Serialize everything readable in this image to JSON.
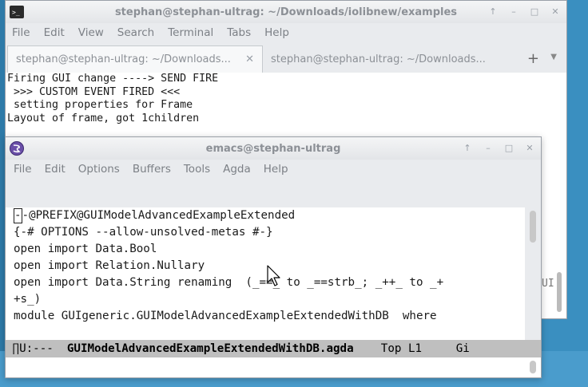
{
  "terminal": {
    "title": "stephan@stephan-ultrag: ~/Downloads/iolibnew/examples",
    "window_buttons": [
      "↑",
      "–",
      "□",
      "✕"
    ],
    "menu": [
      "File",
      "Edit",
      "View",
      "Search",
      "Terminal",
      "Tabs",
      "Help"
    ],
    "tabs": [
      {
        "label": "stephan@stephan-ultrag: ~/Downloads...",
        "close": "✕"
      },
      {
        "label": "stephan@stephan-ultrag: ~/Downloads..."
      }
    ],
    "new_tab": "+",
    "tab_menu": "▼",
    "lines": [
      "Firing GUI change ----> SEND FIRE",
      " >>> CUSTOM EVENT FIRED <<<",
      " setting properties for Frame",
      "Layout of frame, got 1children"
    ],
    "peek_text": "UI"
  },
  "emacs": {
    "title": "emacs@stephan-ultrag",
    "window_buttons": [
      "↑",
      "–",
      "□",
      "✕"
    ],
    "menu": [
      "File",
      "Edit",
      "Options",
      "Buffers",
      "Tools",
      "Agda",
      "Help"
    ],
    "cursor_char": "-",
    "line1_rest": "-@PREFIX@GUIModelAdvancedExampleExtended",
    "lines": [
      "{-# OPTIONS --allow-unsolved-metas #-}",
      "open import Data.Bool",
      "open import Relation.Nullary",
      "open import Data.String renaming  (_==_ to _==strb_; _++_ to _+",
      "+s_)",
      "module GUIgeneric.GUIModelAdvancedExampleExtendedWithDB  where"
    ],
    "modeline": {
      "status": " ∏U:--- ",
      "buffer": " GUIModelAdvancedExampleExtendedWithDB.agda",
      "position": "    Top L1     Gi"
    }
  }
}
